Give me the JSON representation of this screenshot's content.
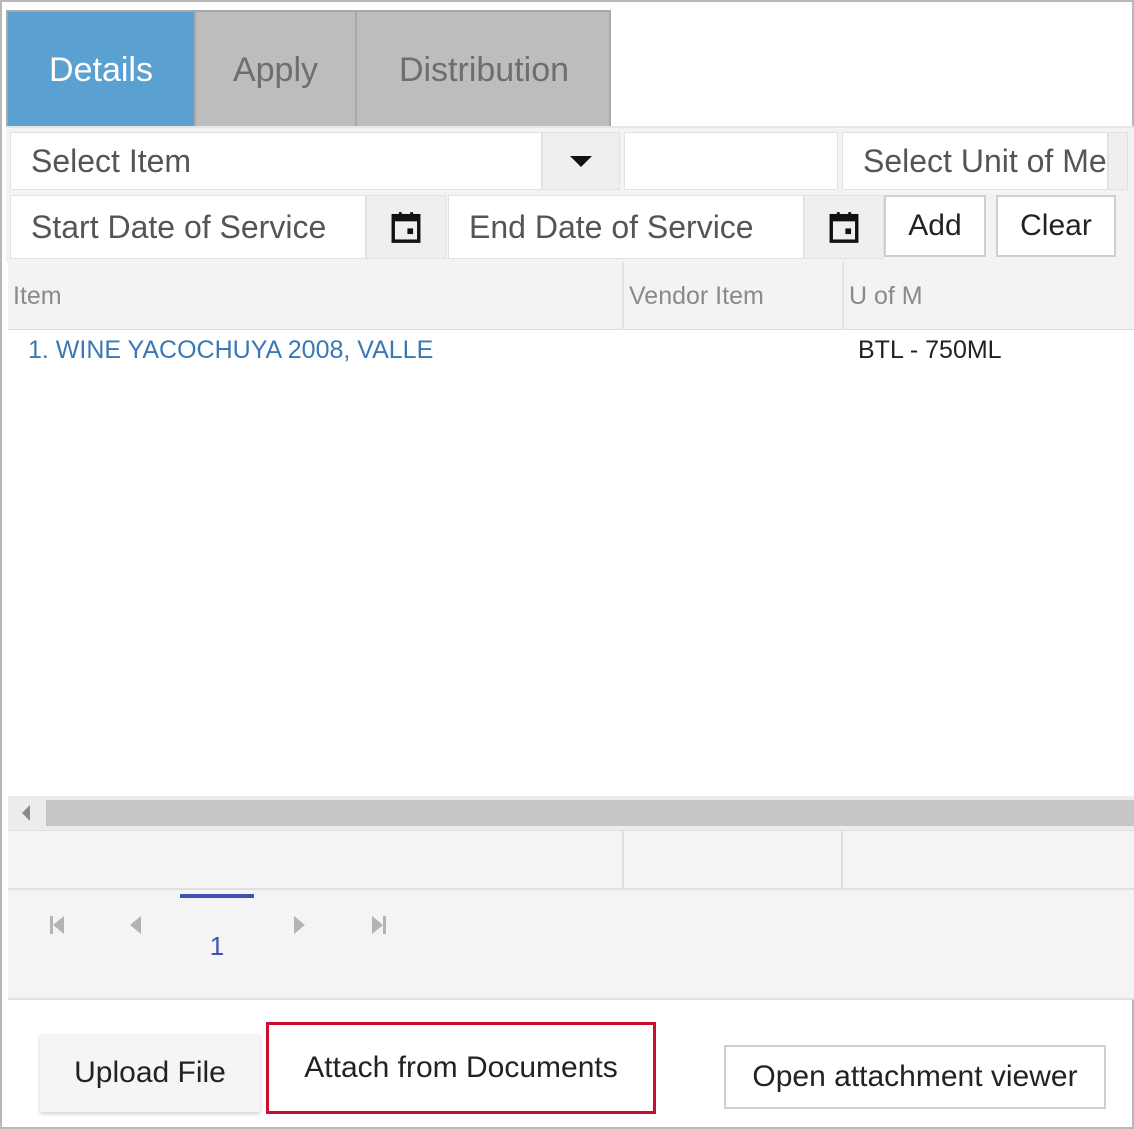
{
  "tabs": [
    {
      "label": "Details",
      "active": true
    },
    {
      "label": "Apply",
      "active": false
    },
    {
      "label": "Distribution",
      "active": false
    }
  ],
  "form": {
    "select_item_placeholder": "Select Item",
    "blank_value": "",
    "unit_placeholder": "Select Unit of Measure",
    "start_date_placeholder": "Start Date of Service",
    "end_date_placeholder": "End Date of Service",
    "add_label": "Add",
    "clear_label": "Clear"
  },
  "grid": {
    "columns": [
      "Item",
      "Vendor Item",
      "U of M"
    ],
    "rows": [
      {
        "item": "1. WINE YACOCHUYA 2008, VALLE",
        "vendor_item": "",
        "uom": "BTL - 750ML"
      }
    ]
  },
  "pager": {
    "current_page": "1"
  },
  "actions": {
    "upload_label": "Upload File",
    "attach_label": "Attach from Documents",
    "viewer_label": "Open attachment viewer"
  },
  "colors": {
    "active_tab": "#5aa1d2",
    "link": "#3a78b5",
    "pager_accent": "#3f51b5",
    "highlight_border": "#c8102e"
  },
  "icons": {
    "dropdown": "caret-down-icon",
    "calendar": "calendar-icon",
    "first": "first-page-icon",
    "prev": "prev-page-icon",
    "next": "next-page-icon",
    "last": "last-page-icon"
  }
}
